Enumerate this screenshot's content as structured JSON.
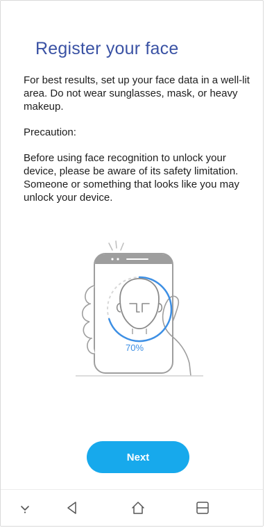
{
  "page": {
    "title": "Register your face",
    "intro": "For best results, set up your face data in a well-lit area. Do not wear sunglasses, mask, or heavy makeup.",
    "precaution_heading": "Precaution:",
    "precaution_text": "Before using face recognition to unlock your device, please be aware of its safety limitation. Someone or something that looks like you may unlock your device."
  },
  "illustration": {
    "progress_label": "70%",
    "progress_value": 0.7,
    "accent_color": "#3d8fe4"
  },
  "actions": {
    "next_label": "Next"
  },
  "navbar": {
    "icons": [
      "hide-keyboard-icon",
      "back-icon",
      "home-icon",
      "recent-apps-icon"
    ]
  },
  "colors": {
    "title": "#3a52a4",
    "button": "#17a9ec"
  }
}
